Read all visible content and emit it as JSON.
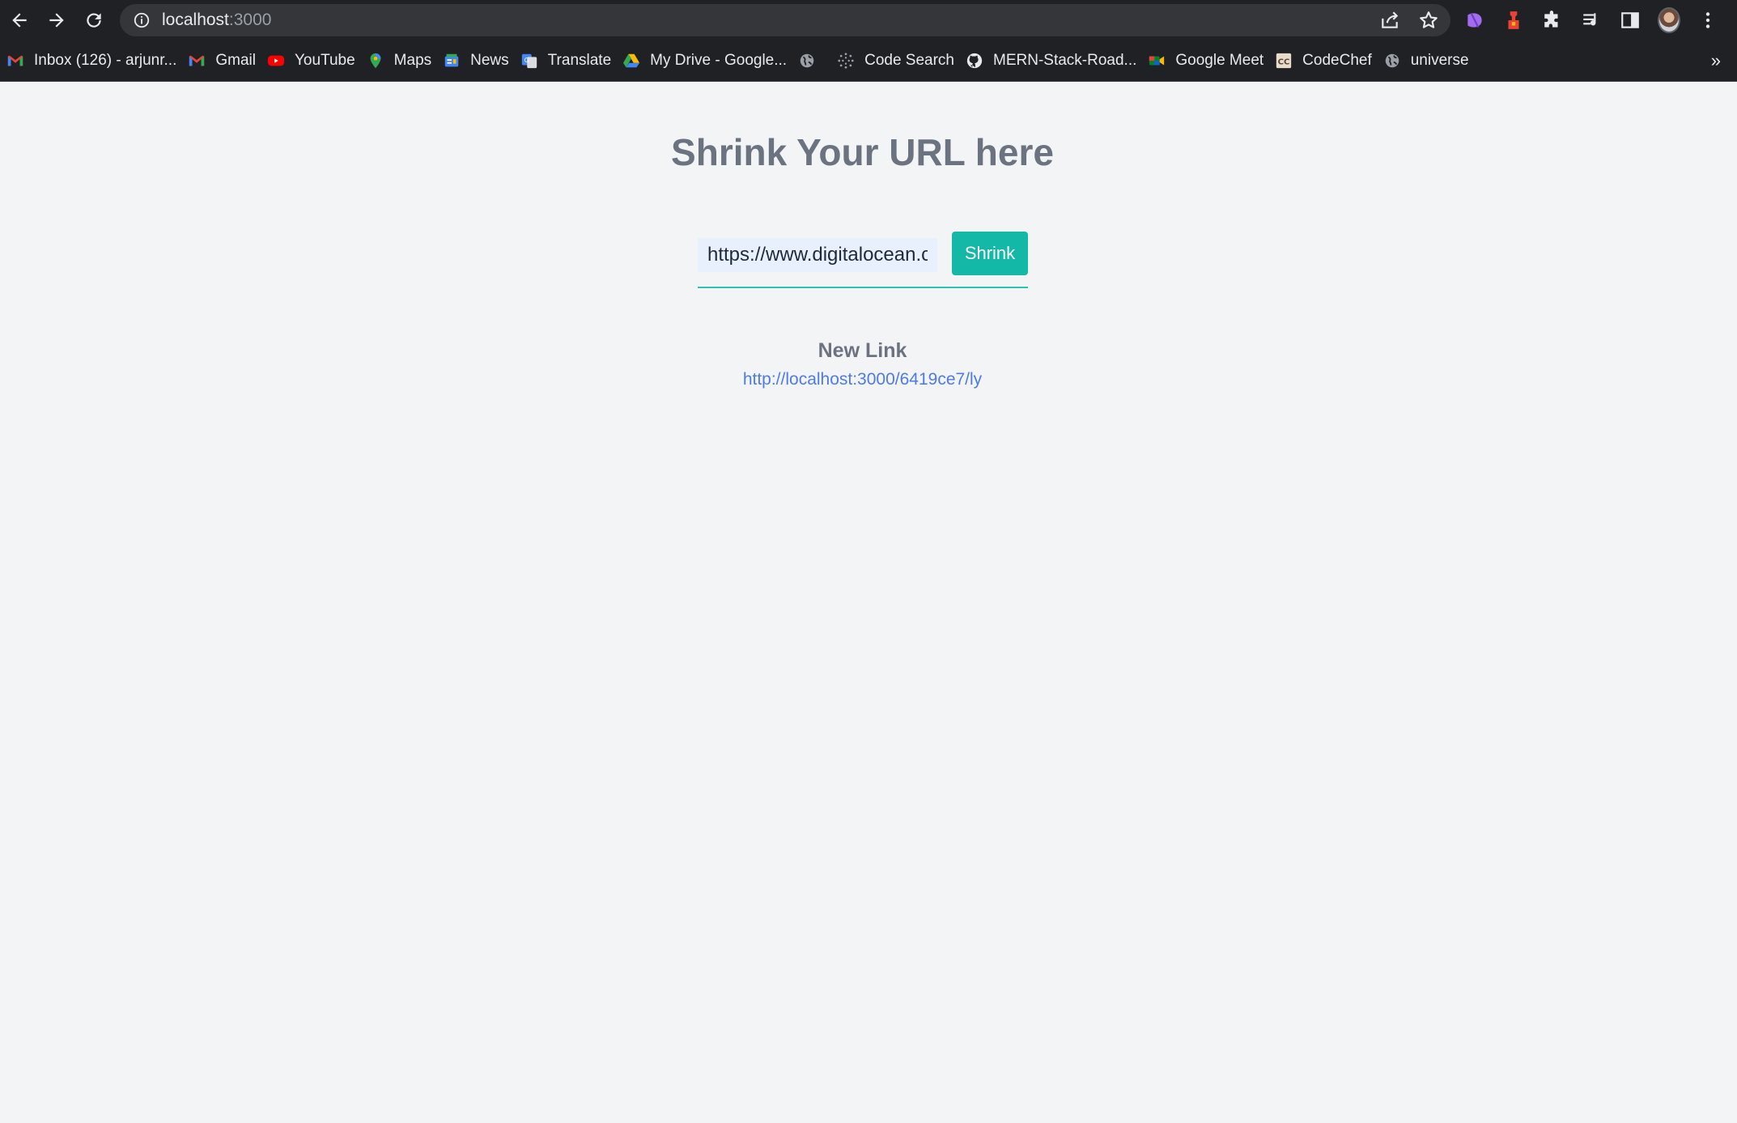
{
  "browser": {
    "url_host": "localhost",
    "url_port": ":3000",
    "bookmarks": [
      {
        "label": "Inbox (126) - arjunr...",
        "icon": "gmail-icon"
      },
      {
        "label": "Gmail",
        "icon": "gmail-icon"
      },
      {
        "label": "YouTube",
        "icon": "youtube-icon"
      },
      {
        "label": "Maps",
        "icon": "maps-pin-icon"
      },
      {
        "label": "News",
        "icon": "news-icon"
      },
      {
        "label": "Translate",
        "icon": "translate-icon"
      },
      {
        "label": "My Drive - Google...",
        "icon": "drive-icon"
      },
      {
        "label": "",
        "icon": "globe-icon"
      },
      {
        "label": "Code Search",
        "icon": "code-search-icon"
      },
      {
        "label": "MERN-Stack-Road...",
        "icon": "github-icon"
      },
      {
        "label": "Google Meet",
        "icon": "meet-icon"
      },
      {
        "label": "CodeChef",
        "icon": "codechef-icon"
      },
      {
        "label": "universe",
        "icon": "globe-icon"
      }
    ],
    "more_bookmarks": "»"
  },
  "main": {
    "title": "Shrink Your URL here",
    "input_value": "https://www.digitalocean.com/community/tutorials",
    "shrink_label": "Shrink",
    "new_link_label": "New Link",
    "new_link_url": "http://localhost:3000/6419ce7/ly"
  },
  "colors": {
    "accent": "#14b8a6",
    "link": "#4f7be6",
    "heading": "#6b7280"
  }
}
